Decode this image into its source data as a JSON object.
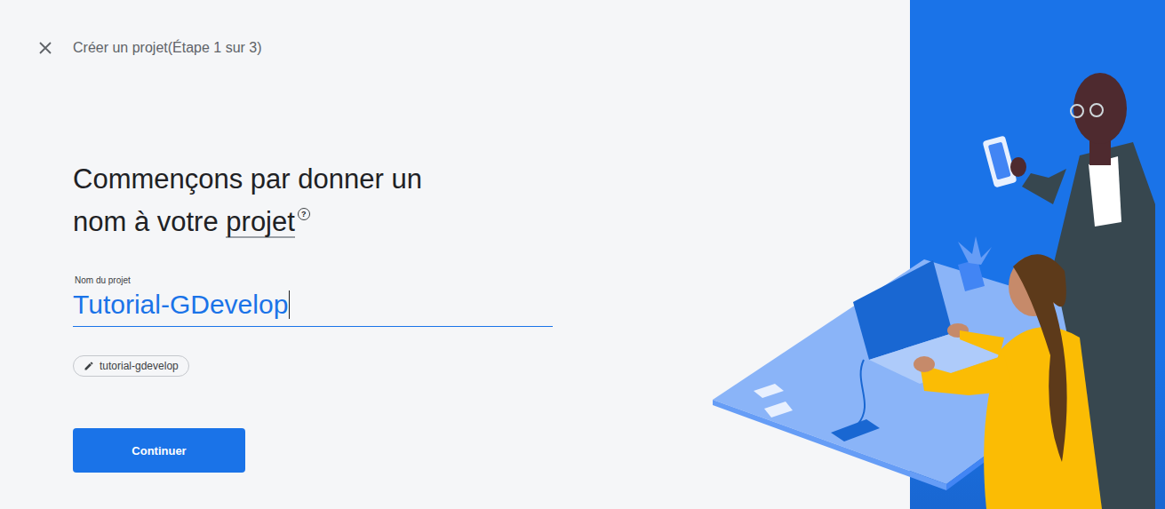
{
  "header": {
    "title": "Créer un projet(Étape 1 sur 3)"
  },
  "heading": {
    "line1": "Commençons par donner un",
    "line2_prefix": "nom à votre",
    "term": "projet",
    "help_glyph": "?"
  },
  "field": {
    "label": "Nom du projet",
    "value": "Tutorial-GDevelop",
    "focused": true
  },
  "project_id_chip": {
    "label": "tutorial-gdevelop"
  },
  "buttons": [
    {
      "label": "Continuer",
      "primary": true
    }
  ]
}
